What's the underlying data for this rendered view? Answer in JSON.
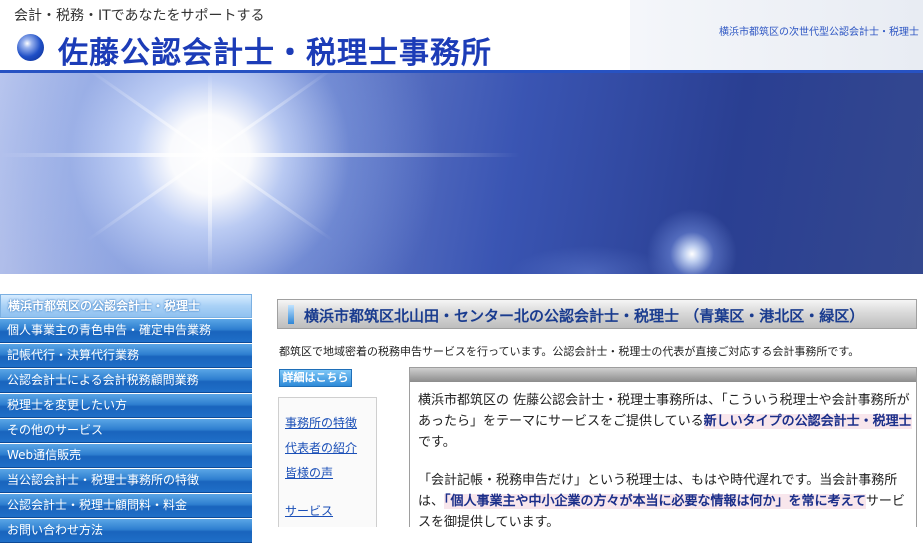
{
  "header": {
    "tagline": "会計・税務・ITであなたをサポートする",
    "title": "佐藤公認会計士・税理士事務所",
    "right_text": "横浜市都筑区の次世代型公認会計士・税理士"
  },
  "sidebar": {
    "items": [
      {
        "label": "横浜市都筑区の公認会計士・税理士",
        "active": true
      },
      {
        "label": "個人事業主の青色申告・確定申告業務"
      },
      {
        "label": "記帳代行・決算代行業務"
      },
      {
        "label": "公認会計士による会計税務顧問業務"
      },
      {
        "label": "税理士を変更したい方"
      },
      {
        "label": "その他のサービス"
      },
      {
        "label": "Web通信販売"
      },
      {
        "label": "当公認会計士・税理士事務所の特徴"
      },
      {
        "label": "公認会計士・税理士顧問料・料金"
      },
      {
        "label": "お問い合わせ方法"
      }
    ]
  },
  "main": {
    "heading": "横浜市都筑区北山田・センター北の公認会計士・税理士 （青葉区・港北区・緑区）",
    "intro": "都筑区で地域密着の税務申告サービスを行っています。公認会計士・税理士の代表が直接ご対応する会計事務所です。",
    "details_button": "詳細はこちら",
    "subnav": [
      "事務所の特徴",
      "代表者の紹介",
      "皆様の声",
      "サービス"
    ],
    "para1_a": "横浜市都筑区の 佐藤公認会計士・税理士事務所は、「こういう税理士や会計事務所があったら」をテーマにサービスをご提供している",
    "para1_hl": "新しいタイプの公認会計士・税理士",
    "para1_b": "です。",
    "para2_a": "「会計記帳・税務申告だけ」という税理士は、もはや時代遅れです。当会計事務所は、",
    "para2_hl": "「個人事業主や中小企業の方々が本当に必要な情報は何か」を常に考えて",
    "para2_b": "サービスを御提供しています。"
  },
  "colors": {
    "brand_blue": "#1c3cb7",
    "nav_blue": "#1f6fc8",
    "link_blue": "#1a4fb7",
    "highlight_bg": "#f8e6ec"
  }
}
